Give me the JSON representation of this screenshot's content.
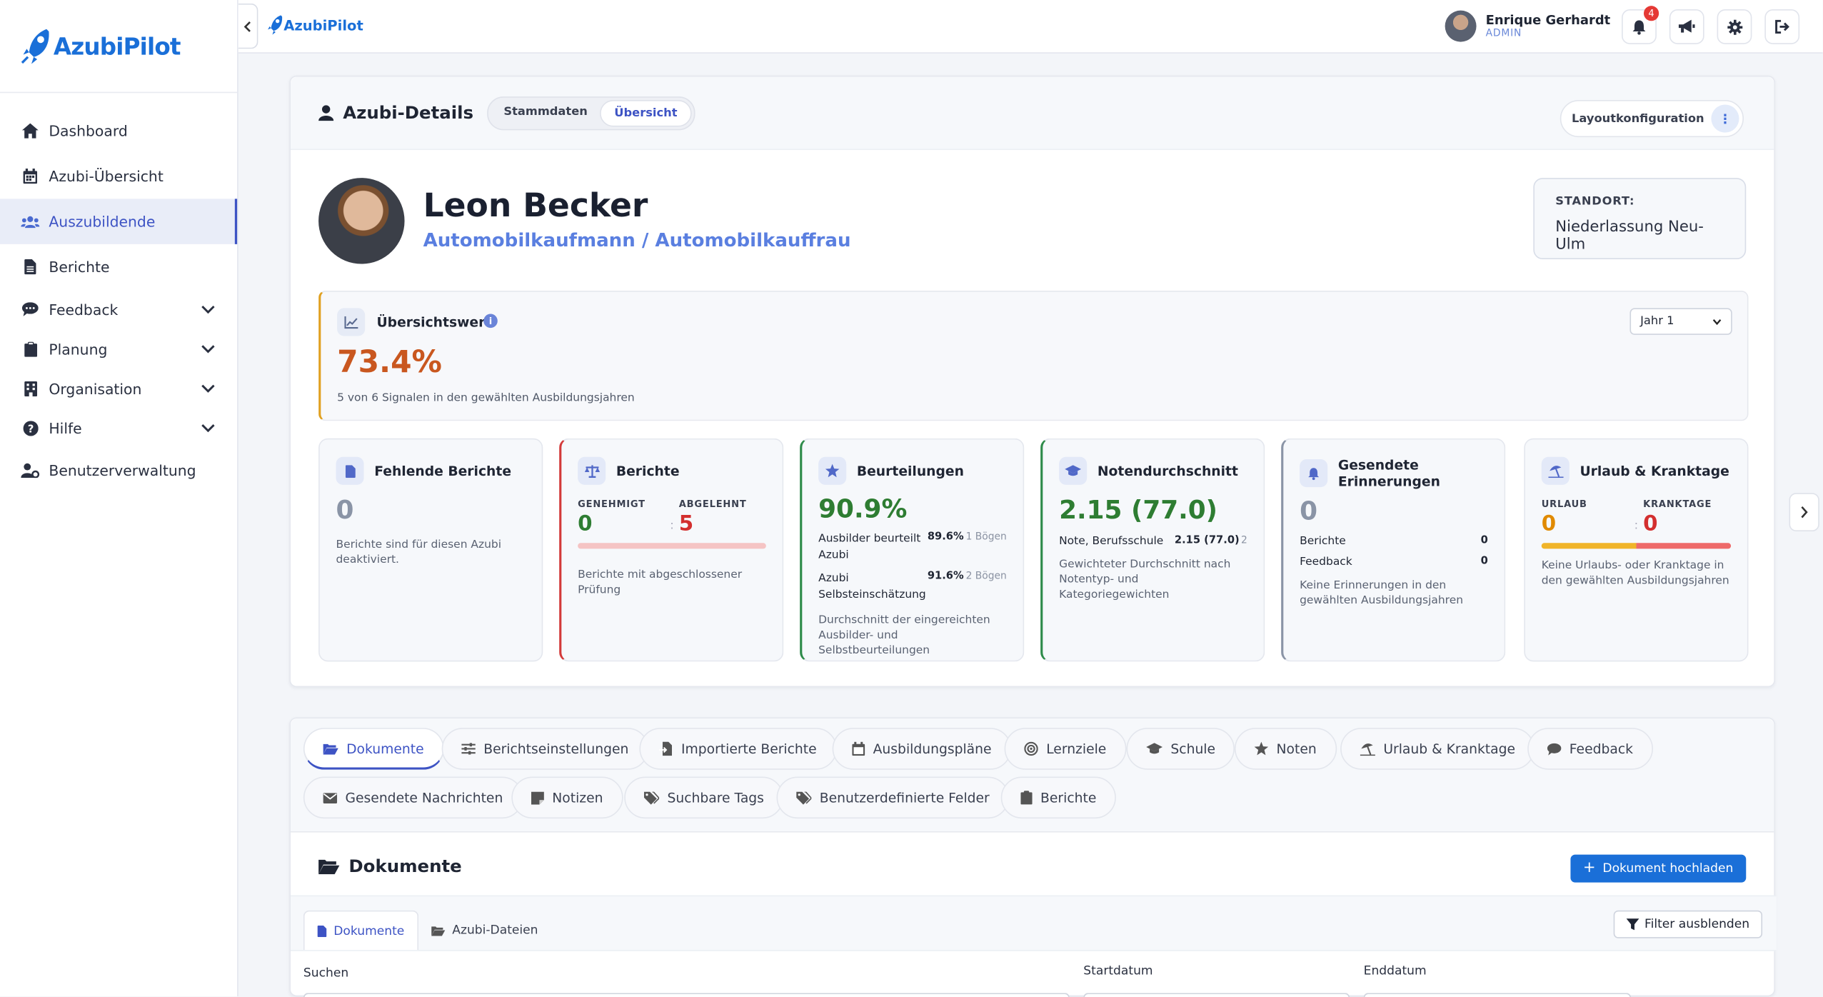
{
  "app": {
    "name": "AzubiPilot"
  },
  "sidebar": {
    "items": [
      {
        "label": "Dashboard",
        "icon": "home-icon"
      },
      {
        "label": "Azubi-Übersicht",
        "icon": "calendar-icon"
      },
      {
        "label": "Auszubildende",
        "icon": "users-icon",
        "active": true
      },
      {
        "label": "Berichte",
        "icon": "file-icon"
      },
      {
        "label": "Feedback",
        "icon": "comments-icon",
        "expandable": true
      },
      {
        "label": "Planung",
        "icon": "clipboard-icon",
        "expandable": true
      },
      {
        "label": "Organisation",
        "icon": "building-icon",
        "expandable": true
      },
      {
        "label": "Hilfe",
        "icon": "question-icon",
        "expandable": true
      },
      {
        "label": "Benutzerverwaltung",
        "icon": "user-cog-icon"
      }
    ]
  },
  "topbar": {
    "user_name": "Enrique Gerhardt",
    "user_role": "ADMIN",
    "notification_count": "4"
  },
  "details": {
    "title": "Azubi-Details",
    "tabs": [
      "Stammdaten",
      "Übersicht"
    ],
    "layout_button": "Layoutkonfiguration",
    "name": "Leon Becker",
    "job": "Automobilkaufmann / Automobilkauffrau",
    "standort_label": "STANDORT:",
    "standort_value": "Niederlassung Neu-Ulm"
  },
  "overview": {
    "title": "Übersichtswert",
    "value": "73.4%",
    "subtitle": "5 von 6 Signalen in den gewählten Ausbildungsjahren",
    "year_select": "Jahr 1"
  },
  "kpis": {
    "fehlende": {
      "title": "Fehlende Berichte",
      "value": "0",
      "note": "Berichte sind für diesen Azubi deaktiviert."
    },
    "berichte": {
      "title": "Berichte",
      "label_a": "GENEHMIGT",
      "value_a": "0",
      "label_b": "ABGELEHNT",
      "value_b": "5",
      "note": "Berichte mit abgeschlossener Prüfung"
    },
    "beurteilungen": {
      "title": "Beurteilungen",
      "value": "90.9%",
      "row1_label": "Ausbilder beurteilt Azubi",
      "row1_value": "89.6%",
      "row1_count": "1 Bögen",
      "row2_label": "Azubi Selbsteinschätzung",
      "row2_value": "91.6%",
      "row2_count": "2 Bögen",
      "note": "Durchschnitt der eingereichten Ausbilder- und Selbstbeurteilungen"
    },
    "noten": {
      "title": "Notendurchschnitt",
      "value": "2.15 (77.0)",
      "row_label": "Note, Berufsschule",
      "row_value": "2.15 (77.0)",
      "row_count": "2",
      "note": "Gewichteter Durchschnitt nach Notentyp- und Kategoriegewichten"
    },
    "erinnerungen": {
      "title": "Gesendete Erinnerungen",
      "value": "0",
      "row1_label": "Berichte",
      "row1_value": "0",
      "row2_label": "Feedback",
      "row2_value": "0",
      "note": "Keine Erinnerungen in den gewählten Ausbildungsjahren"
    },
    "urlaub": {
      "title": "Urlaub & Kranktage",
      "label_a": "URLAUB",
      "value_a": "0",
      "label_b": "KRANKTAGE",
      "value_b": "0",
      "note": "Keine Urlaubs- oder Kranktage in den gewählten Ausbildungsjahren"
    }
  },
  "tabs": [
    "Dokumente",
    "Berichtseinstellungen",
    "Importierte Berichte",
    "Ausbildungspläne",
    "Lernziele",
    "Schule",
    "Noten",
    "Urlaub & Kranktage",
    "Feedback",
    "Gesendete Nachrichten",
    "Notizen",
    "Suchbare Tags",
    "Benutzerdefinierte Felder",
    "Berichte"
  ],
  "documents": {
    "title": "Dokumente",
    "upload_button": "Dokument hochladen",
    "subtabs": [
      "Dokumente",
      "Azubi-Dateien"
    ],
    "filter_button": "Filter ausblenden",
    "search_label": "Suchen",
    "start_label": "Startdatum",
    "end_label": "Enddatum"
  },
  "colors": {
    "accent": "#3d53c4",
    "brand": "#1a6fd8",
    "overview_value": "#c9571f",
    "red": "#d32f2f",
    "green": "#2e7d32",
    "orange": "#e0a020"
  }
}
